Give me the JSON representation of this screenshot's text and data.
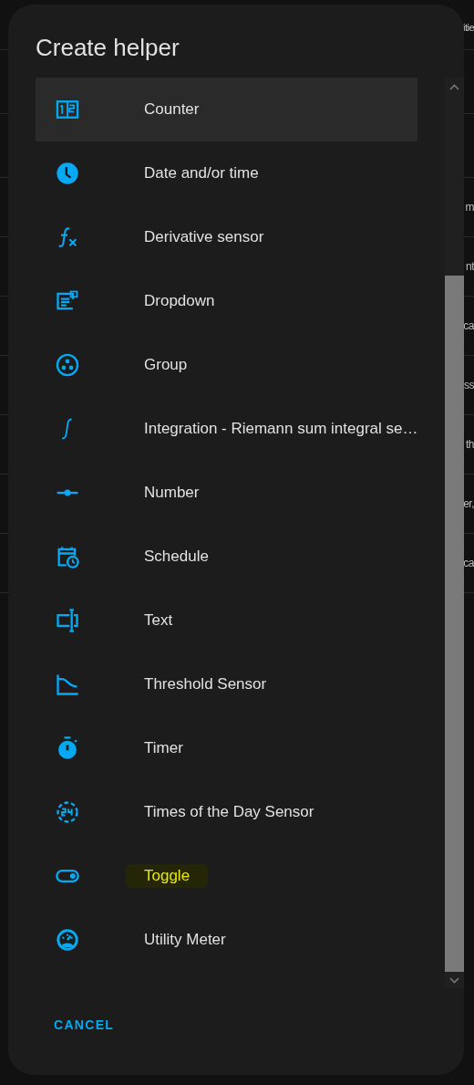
{
  "background": {
    "heading_fragment": "itie",
    "row_fragments": [
      "m",
      "nt",
      "ca",
      "ss",
      "th",
      "er,",
      "ca"
    ]
  },
  "dialog": {
    "title": "Create helper",
    "items": [
      {
        "kind": "counter",
        "label": "Counter",
        "selected": true,
        "highlighted": false
      },
      {
        "kind": "clock",
        "label": "Date and/or time",
        "selected": false,
        "highlighted": false
      },
      {
        "kind": "function",
        "label": "Derivative sensor",
        "selected": false,
        "highlighted": false
      },
      {
        "kind": "dropdown",
        "label": "Dropdown",
        "selected": false,
        "highlighted": false
      },
      {
        "kind": "group",
        "label": "Group",
        "selected": false,
        "highlighted": false
      },
      {
        "kind": "integral",
        "label": "Integration - Riemann sum integral se…",
        "selected": false,
        "highlighted": false
      },
      {
        "kind": "number",
        "label": "Number",
        "selected": false,
        "highlighted": false
      },
      {
        "kind": "schedule",
        "label": "Schedule",
        "selected": false,
        "highlighted": false
      },
      {
        "kind": "text",
        "label": "Text",
        "selected": false,
        "highlighted": false
      },
      {
        "kind": "threshold",
        "label": "Threshold Sensor",
        "selected": false,
        "highlighted": false
      },
      {
        "kind": "timer",
        "label": "Timer",
        "selected": false,
        "highlighted": false
      },
      {
        "kind": "times",
        "label": "Times of the Day Sensor",
        "selected": false,
        "highlighted": false
      },
      {
        "kind": "toggle",
        "label": "Toggle",
        "selected": false,
        "highlighted": true
      },
      {
        "kind": "meter",
        "label": "Utility Meter",
        "selected": false,
        "highlighted": false
      }
    ],
    "cancel_button": "CANCEL"
  }
}
